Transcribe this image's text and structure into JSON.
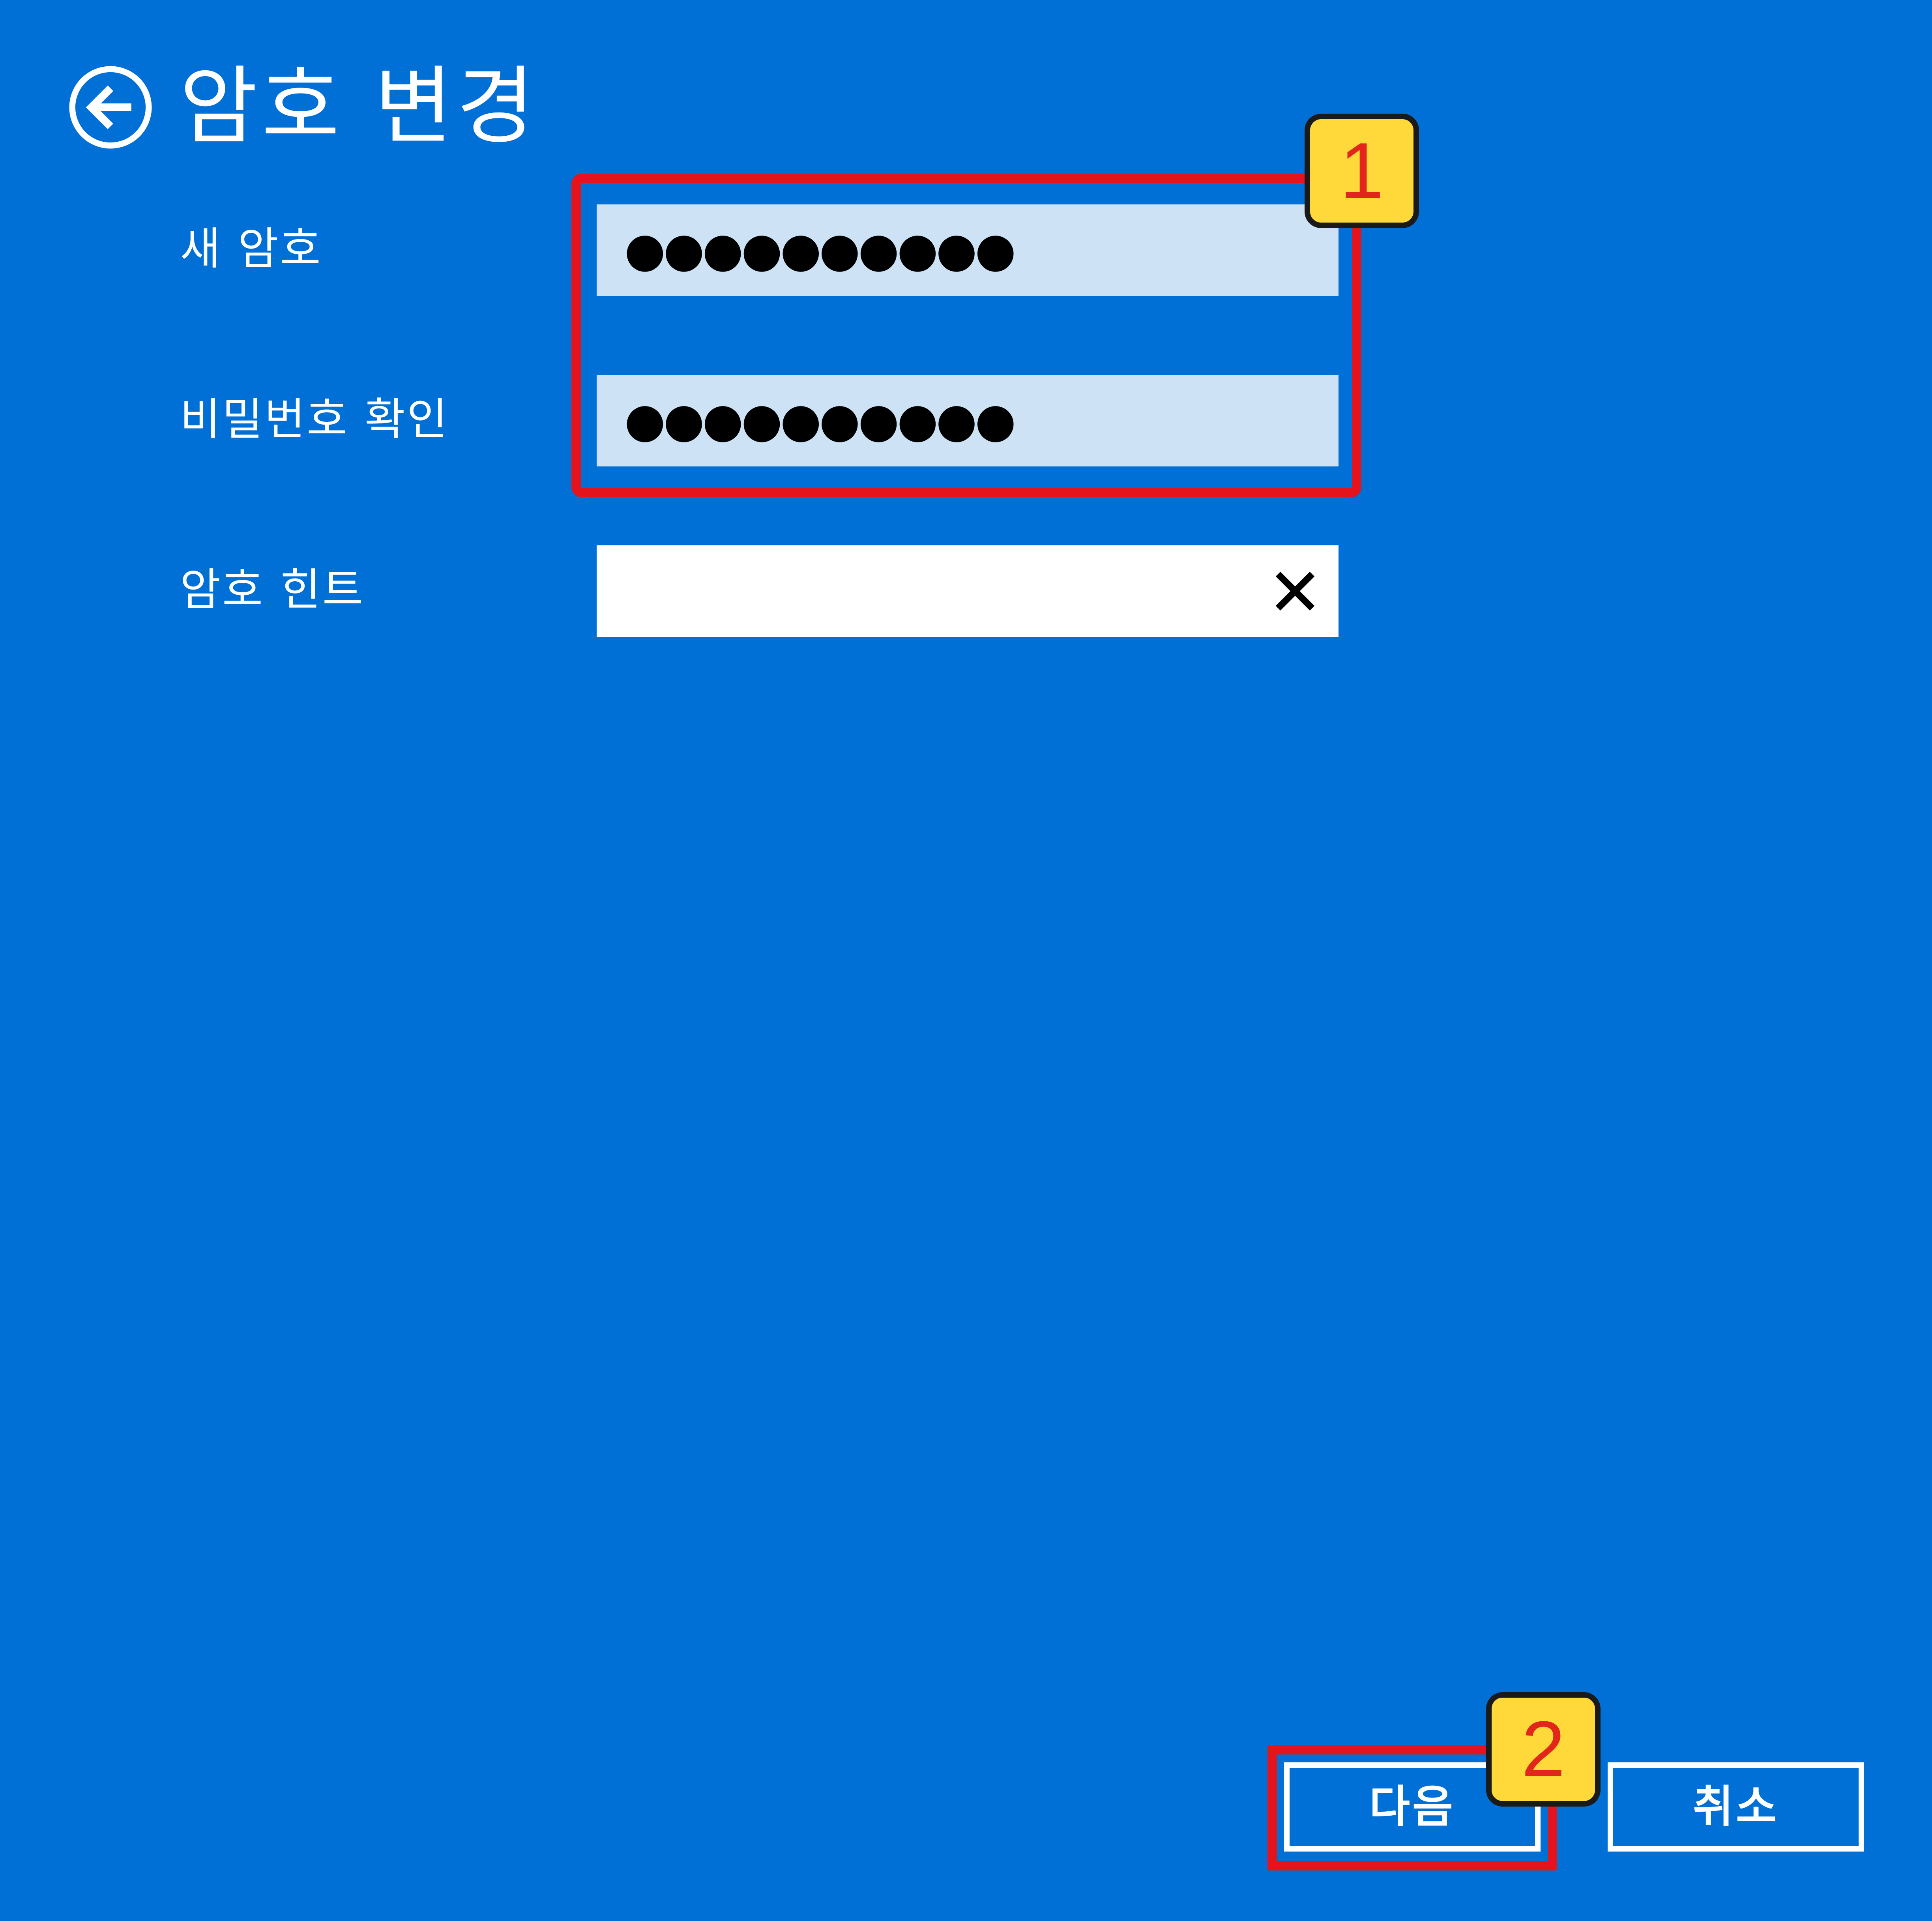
{
  "header": {
    "title": "암호 변경",
    "back_icon": "back-arrow-circle-icon"
  },
  "form": {
    "new_password": {
      "label": "새 암호",
      "value": "●●●●●●●●●●"
    },
    "confirm_password": {
      "label": "비밀번호 확인",
      "value": "●●●●●●●●●●"
    },
    "password_hint": {
      "label": "암호 힌트",
      "value": "",
      "clear_icon": "close-icon"
    }
  },
  "buttons": {
    "next_label": "다음",
    "cancel_label": "취소"
  },
  "annotations": {
    "badge_1": "1",
    "badge_2": "2",
    "highlight_color": "#e3141c",
    "badge_color": "#ffd83a"
  },
  "theme": {
    "background": "#0070d6",
    "field_background": "#cde3f5",
    "text_color": "#ffffff"
  }
}
